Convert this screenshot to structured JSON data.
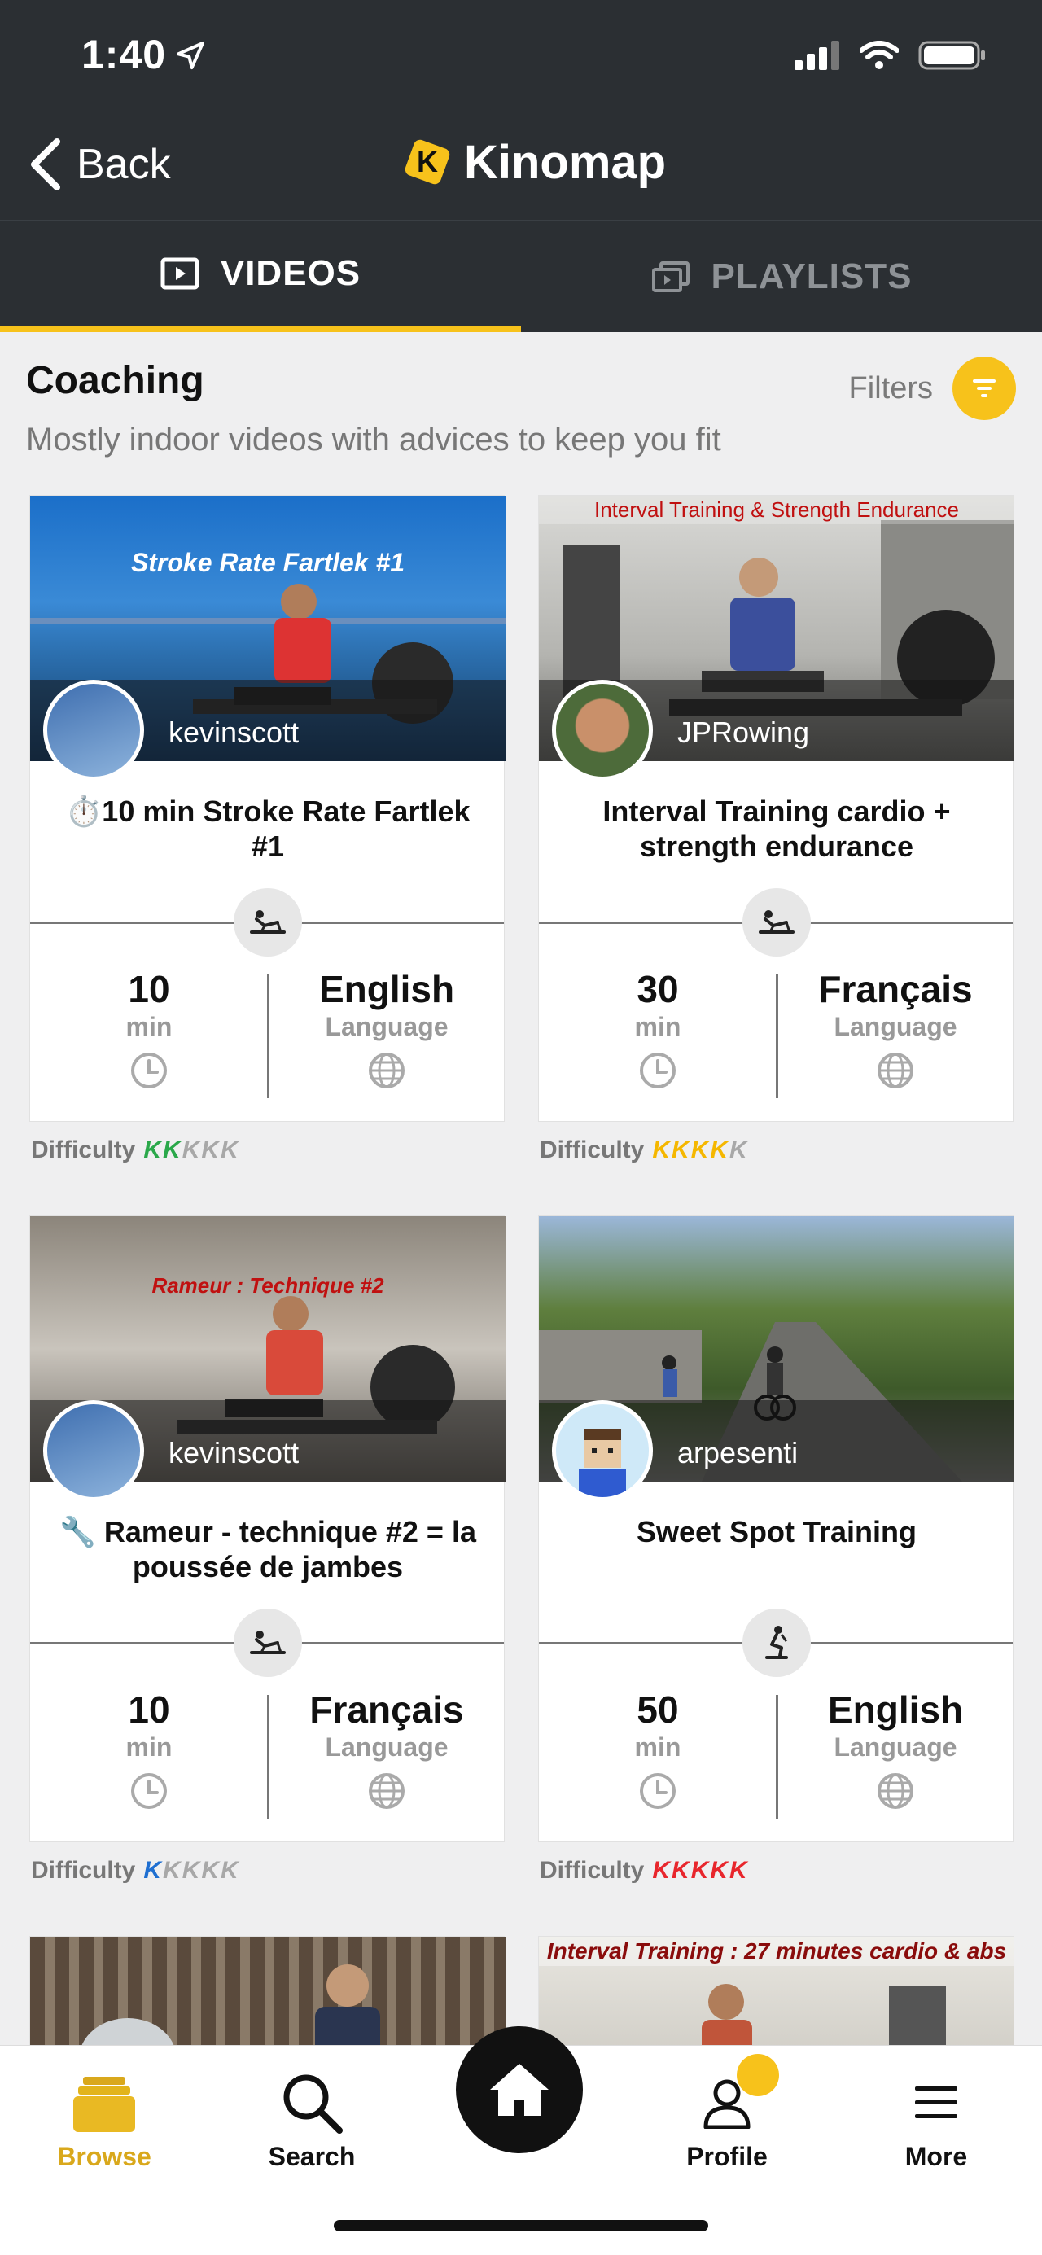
{
  "status_bar": {
    "time": "1:40"
  },
  "nav": {
    "back_label": "Back",
    "logo_text": "Kinomap"
  },
  "tabs": [
    {
      "label": "VIDEOS",
      "active": true
    },
    {
      "label": "PLAYLISTS",
      "active": false
    }
  ],
  "section": {
    "title": "Coaching",
    "subtitle": "Mostly indoor videos with advices to keep you fit",
    "filters_label": "Filters"
  },
  "cards": [
    {
      "thumb_caption": "Stroke Rate Fartlek #1",
      "username": "kevinscott",
      "title": "⏱️10 min Stroke Rate Fartlek #1",
      "sport": "rowing-icon",
      "duration_value": "10",
      "duration_unit": "min",
      "language_value": "English",
      "language_label": "Language",
      "difficulty_label": "Difficulty",
      "difficulty_level": 2,
      "difficulty_color": "#2aa84a"
    },
    {
      "thumb_caption": "Interval Training & Strength Endurance",
      "username": "JPRowing",
      "title": "Interval Training cardio + strength endurance",
      "sport": "rowing-icon",
      "duration_value": "30",
      "duration_unit": "min",
      "language_value": "Français",
      "language_label": "Language",
      "difficulty_label": "Difficulty",
      "difficulty_level": 4,
      "difficulty_color": "#f5b700"
    },
    {
      "thumb_caption": "Rameur : Technique #2",
      "username": "kevinscott",
      "title": "🔧 Rameur - technique #2 = la poussée de jambes",
      "sport": "rowing-icon",
      "duration_value": "10",
      "duration_unit": "min",
      "language_value": "Français",
      "language_label": "Language",
      "difficulty_label": "Difficulty",
      "difficulty_level": 1,
      "difficulty_color": "#1f6fd1"
    },
    {
      "thumb_caption": "",
      "username": "arpesenti",
      "title": "Sweet Spot Training",
      "sport": "cycling-icon",
      "duration_value": "50",
      "duration_unit": "min",
      "language_value": "English",
      "language_label": "Language",
      "difficulty_label": "Difficulty",
      "difficulty_level": 5,
      "difficulty_color": "#e8262c"
    }
  ],
  "partial_cards": [
    {
      "thumb_caption": ""
    },
    {
      "thumb_caption": "Interval Training : 27 minutes cardio & abs"
    }
  ],
  "bottom_nav": {
    "browse": "Browse",
    "search": "Search",
    "profile": "Profile",
    "more": "More"
  },
  "colors": {
    "accent": "#f7c21b",
    "header": "#2b2f33"
  }
}
